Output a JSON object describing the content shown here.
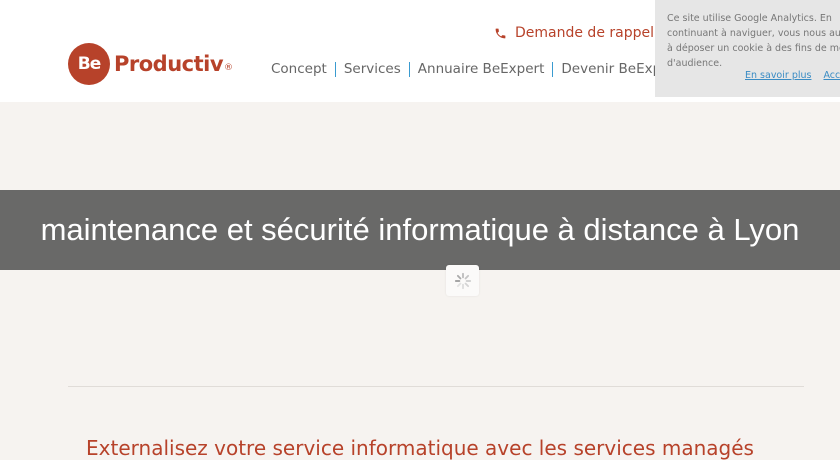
{
  "brand": {
    "logo_mark": "Be",
    "logo_text": "Productiv",
    "logo_reg": "®",
    "color": "#b7422a"
  },
  "header": {
    "callback_label": "Demande de rappel",
    "callback_icon": "phone-icon",
    "nav": [
      {
        "label": "Concept"
      },
      {
        "label": "Services"
      },
      {
        "label": "Annuaire BeExpert"
      },
      {
        "label": "Devenir BeExpert"
      }
    ]
  },
  "cookie_notice": {
    "lines": [
      "Ce site utilise Google Analytics. En",
      "continuant à naviguer, vous nous autorisez",
      "à déposer un cookie à des fins de mesure",
      "d'audience."
    ],
    "more_label": "En savoir plus",
    "accept_label": "Accepter"
  },
  "hero": {
    "title": "maintenance et sécurité informatique à distance à Lyon"
  },
  "main": {
    "subtitle": "Externalisez votre service informatique avec les services managés"
  }
}
